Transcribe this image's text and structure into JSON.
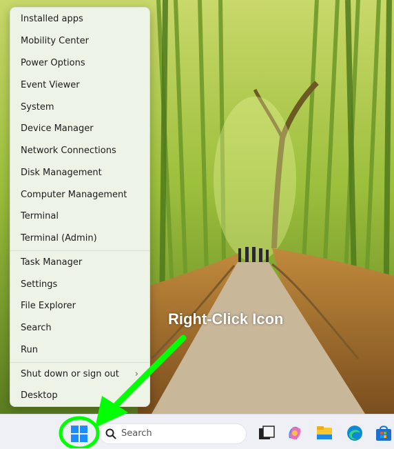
{
  "menu": {
    "items": [
      {
        "label": "Installed apps"
      },
      {
        "label": "Mobility Center"
      },
      {
        "label": "Power Options"
      },
      {
        "label": "Event Viewer"
      },
      {
        "label": "System"
      },
      {
        "label": "Device Manager"
      },
      {
        "label": "Network Connections"
      },
      {
        "label": "Disk Management"
      },
      {
        "label": "Computer Management"
      },
      {
        "label": "Terminal"
      },
      {
        "label": "Terminal (Admin)"
      },
      {
        "label": "Task Manager"
      },
      {
        "label": "Settings"
      },
      {
        "label": "File Explorer"
      },
      {
        "label": "Search"
      },
      {
        "label": "Run"
      },
      {
        "label": "Shut down or sign out"
      },
      {
        "label": "Desktop"
      }
    ],
    "submenu_chevron": "›"
  },
  "taskbar": {
    "search_placeholder": "Search",
    "icons": [
      "start-icon",
      "search-icon",
      "task-view-icon",
      "copilot-icon",
      "file-explorer-icon",
      "edge-icon",
      "store-icon"
    ]
  },
  "annotation": {
    "label": "Right-Click Icon",
    "color": "#00ff00"
  },
  "colors": {
    "menu_bg": "#eef3e8",
    "taskbar_bg": "#eef0f5",
    "start_blue": "#1a8cff"
  }
}
